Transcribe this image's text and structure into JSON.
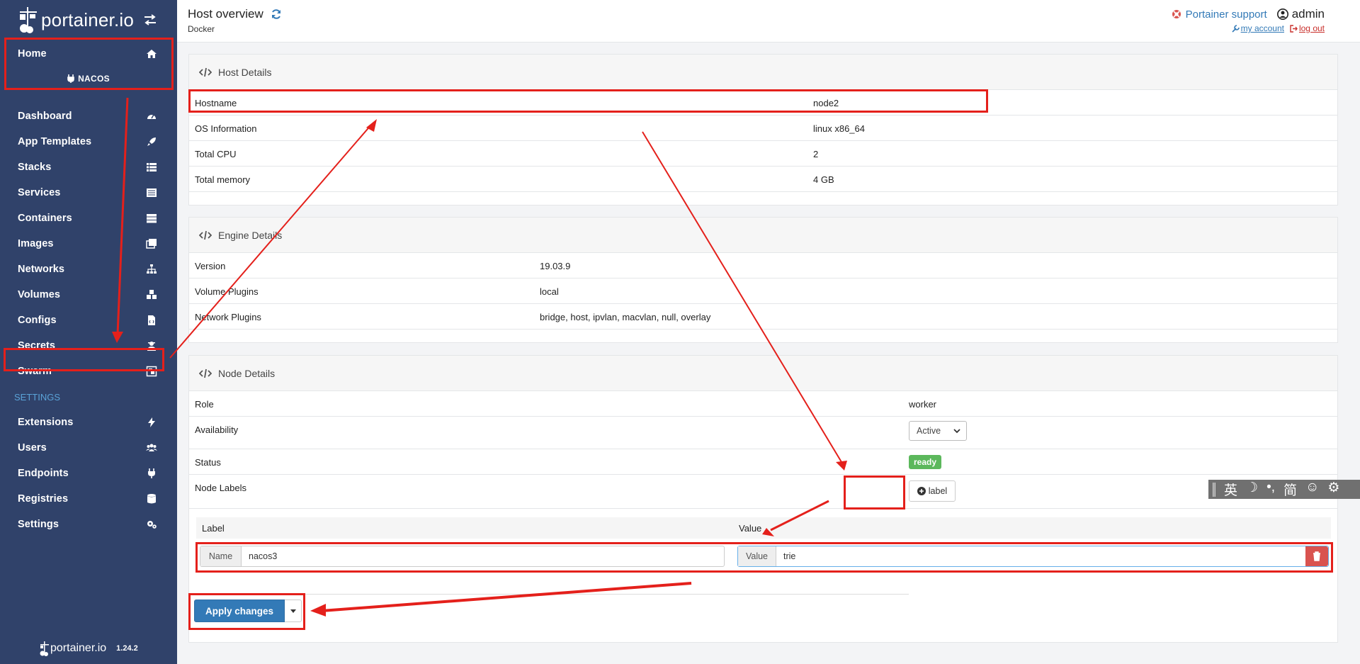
{
  "brand": {
    "name": "portainer.io"
  },
  "sidebar": {
    "home_label": "Home",
    "endpoint_name": "NACOS",
    "items": [
      {
        "label": "Dashboard",
        "icon": "dashboard-icon"
      },
      {
        "label": "App Templates",
        "icon": "rocket-icon"
      },
      {
        "label": "Stacks",
        "icon": "list-icon"
      },
      {
        "label": "Services",
        "icon": "services-icon"
      },
      {
        "label": "Containers",
        "icon": "server-icon"
      },
      {
        "label": "Images",
        "icon": "images-icon"
      },
      {
        "label": "Networks",
        "icon": "sitemap-icon"
      },
      {
        "label": "Volumes",
        "icon": "cubes-icon"
      },
      {
        "label": "Configs",
        "icon": "file-code-icon"
      },
      {
        "label": "Secrets",
        "icon": "user-secret-icon"
      },
      {
        "label": "Swarm",
        "icon": "object-group-icon"
      }
    ],
    "settings_title": "SETTINGS",
    "settings_items": [
      {
        "label": "Extensions",
        "icon": "bolt-icon"
      },
      {
        "label": "Users",
        "icon": "users-icon"
      },
      {
        "label": "Endpoints",
        "icon": "plug-icon"
      },
      {
        "label": "Registries",
        "icon": "database-icon"
      },
      {
        "label": "Settings",
        "icon": "cogs-icon"
      }
    ],
    "footer_brand": "portainer.io",
    "version": "1.24.2"
  },
  "header": {
    "title": "Host overview",
    "breadcrumb": "Docker",
    "support_label": "Portainer support",
    "username": "admin",
    "my_account": "my account",
    "log_out": "log out"
  },
  "host_details": {
    "title": "Host Details",
    "rows": [
      {
        "key": "Hostname",
        "value": "node2"
      },
      {
        "key": "OS Information",
        "value": "linux x86_64"
      },
      {
        "key": "Total CPU",
        "value": "2"
      },
      {
        "key": "Total memory",
        "value": "4 GB"
      }
    ]
  },
  "engine_details": {
    "title": "Engine Details",
    "rows": [
      {
        "key": "Version",
        "value": "19.03.9"
      },
      {
        "key": "Volume Plugins",
        "value": "local"
      },
      {
        "key": "Network Plugins",
        "value": "bridge, host, ipvlan, macvlan, null, overlay"
      }
    ]
  },
  "node_details": {
    "title": "Node Details",
    "role_key": "Role",
    "role_value": "worker",
    "availability_key": "Availability",
    "availability_value": "Active",
    "status_key": "Status",
    "status_value": "ready",
    "labels_key": "Node Labels",
    "add_label_button": "label",
    "label_col": "Label",
    "value_col": "Value",
    "name_addon": "Name",
    "name_value": "nacos3",
    "value_addon": "Value",
    "value_value": "trie",
    "apply_button": "Apply changes"
  },
  "ime": {
    "items": [
      "英",
      "☽",
      "•,",
      "简",
      "☺",
      "⚙"
    ]
  },
  "colors": {
    "sidebar_bg": "#30426a",
    "primary": "#337ab7",
    "danger": "#d9534f",
    "success": "#5cb85c",
    "annotation": "#e4201b"
  }
}
